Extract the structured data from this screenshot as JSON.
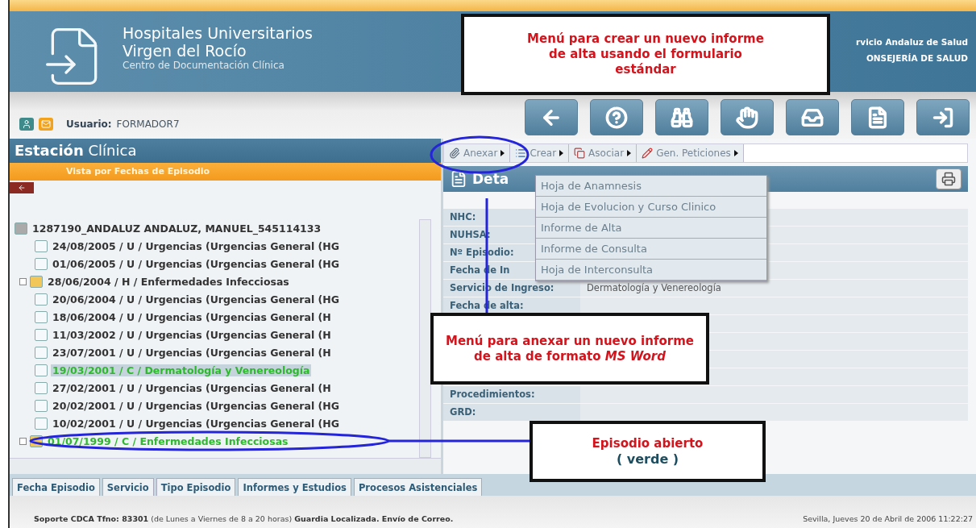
{
  "header": {
    "title_lines": [
      "Hospitales Universitarios",
      "Virgen del Rocío"
    ],
    "subtitle": "Centro de Documentación Clínica",
    "org_lines": [
      "rvicio Andaluz de Salud",
      "ONSEJERÍA DE SALUD"
    ]
  },
  "user": {
    "label": "Usuario:",
    "name": "FORMADOR7"
  },
  "toolbar": [
    {
      "kind": "back"
    },
    {
      "kind": "help"
    },
    {
      "kind": "search"
    },
    {
      "kind": "hand"
    },
    {
      "kind": "tray"
    },
    {
      "kind": "paper"
    },
    {
      "kind": "exit"
    }
  ],
  "left_panel": {
    "title": "**Estación** Clínica",
    "subtitle": "Vista por Fechas de Episodio",
    "tree": {
      "label": "1287190_ANDALUZ ANDALUZ, MANUEL_545114133",
      "children": [
        {
          "label": "24/08/2005 / U / Urgencias (Urgencias General (HG",
          "kind": "document",
          "open": false,
          "selected": false
        },
        {
          "label": "01/06/2005 / U / Urgencias (Urgencias General (HG",
          "kind": "document",
          "open": false,
          "selected": false
        },
        {
          "label": "28/06/2004 / H / Enfermedades Infecciosas",
          "kind": "folder",
          "open": false,
          "selected": false,
          "expanded": false
        },
        {
          "label": "20/06/2004 / U / Urgencias (Urgencias General (HG",
          "kind": "document",
          "open": false,
          "selected": false
        },
        {
          "label": "18/06/2004 / U / Urgencias (Urgencias General (H",
          "kind": "document",
          "open": false,
          "selected": false
        },
        {
          "label": "11/03/2002 / U / Urgencias (Urgencias General (H",
          "kind": "document",
          "open": false,
          "selected": false
        },
        {
          "label": "23/07/2001 / U / Urgencias (Urgencias General (H",
          "kind": "document",
          "open": false,
          "selected": false
        },
        {
          "label": "19/03/2001 / C / Dermatología y Venereología",
          "kind": "document",
          "open": true,
          "selected": true
        },
        {
          "label": "27/02/2001 / U / Urgencias (Urgencias General (H",
          "kind": "document",
          "open": false,
          "selected": false
        },
        {
          "label": "20/02/2001 / U / Urgencias (Urgencias General (HG",
          "kind": "document",
          "open": false,
          "selected": false
        },
        {
          "label": "10/02/2001 / U / Urgencias (Urgencias General (HG",
          "kind": "document",
          "open": false,
          "selected": false
        },
        {
          "label": "01/07/1999 / C / Enfermedades Infecciosas",
          "kind": "folder",
          "open": true,
          "selected": false,
          "expanded": false
        }
      ]
    }
  },
  "menu_bar": [
    {
      "label": "Anexar",
      "kind": "attach"
    },
    {
      "label": "Crear",
      "kind": "create"
    },
    {
      "label": "Asociar",
      "kind": "associate"
    },
    {
      "label": "Gen. Peticiones",
      "kind": "request"
    }
  ],
  "dropdown": [
    "Hoja de Anamnesis",
    "Hoja de Evolucion y Curso Clinico",
    "Informe de Alta",
    "Informe de Consulta",
    "Hoja de Interconsulta"
  ],
  "detail": {
    "title": "Deta",
    "fields_top": [
      {
        "label": "NHC:"
      },
      {
        "label": "NUHSA:"
      },
      {
        "label": "Nº Episodio:"
      },
      {
        "label": "Fecha de In"
      },
      {
        "label": "Servicio de Ingreso:",
        "value": "Dermatología y Venereología"
      },
      {
        "label": "Fecha de alta:"
      }
    ],
    "fields_bottom": [
      {
        "label": "Procedimientos:"
      },
      {
        "label": "GRD:"
      }
    ]
  },
  "bottom_tabs": [
    {
      "label": "Fecha Episodio",
      "selected": false
    },
    {
      "label": "Servicio",
      "selected": false
    },
    {
      "label": "Tipo Episodio",
      "selected": false
    },
    {
      "label": "Informes y Estudios",
      "selected": false
    },
    {
      "label": "Procesos Asistenciales",
      "selected": false
    }
  ],
  "status_bar": {
    "left": "**Soporte CDCA Tfno: 83301** (de Lunes a Viernes de 8 a 20 horas) **Guardia Localizada.   Envío de Correo.**",
    "right": "Sevilla, Jueves 20 de Abril de 2006 11:22:27"
  },
  "callouts": [
    {
      "text": "Menú para crear un nuevo informe de alta usando el formulario estándar"
    },
    {
      "text": "Menú para anexar un nuevo informe de alta de formato *MS Word*"
    },
    {
      "text": "Episodio abierto",
      "note": "( verde )"
    }
  ]
}
